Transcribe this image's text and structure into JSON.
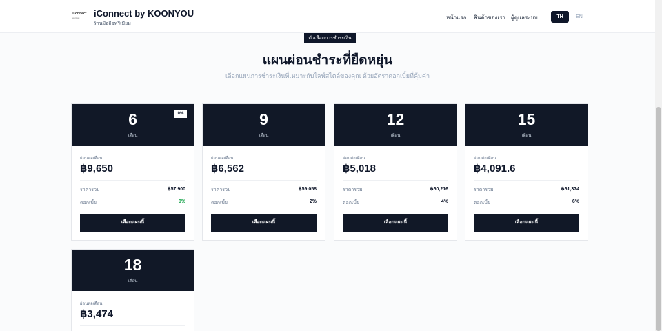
{
  "header": {
    "logo_text": "iConnect",
    "logo_sub": "koonyou",
    "brand_title": "iConnect by KOONYOU",
    "brand_subtitle": "ร้านมือถือพรีเมียม",
    "nav": [
      "หน้าแรก",
      "สินค้าของเรา",
      "ผู้ดูแลระบบ"
    ],
    "lang_active": "TH",
    "lang_other": "EN"
  },
  "section": {
    "badge": "ตัวเลือกการชำระเงิน",
    "title": "แผนผ่อนชำระที่ยืดหยุ่น",
    "description": "เลือกแผนการชำระเงินที่เหมาะกับไลฟ์สไตล์ของคุณ ด้วยอัตราดอกเบี้ยที่คุ้มค่า"
  },
  "labels": {
    "unit": "เดือน",
    "per_month": "ผ่อนต่อเดือน",
    "total": "ราคารวม",
    "interest": "ดอกเบี้ย",
    "select": "เลือกแผนนี้"
  },
  "plans": [
    {
      "months": "6",
      "tag": "0%",
      "per_month": "฿9,650",
      "total": "฿57,900",
      "interest": "0%"
    },
    {
      "months": "9",
      "per_month": "฿6,562",
      "total": "฿59,058",
      "interest": "2%"
    },
    {
      "months": "12",
      "per_month": "฿5,018",
      "total": "฿60,216",
      "interest": "4%"
    },
    {
      "months": "15",
      "per_month": "฿4,091.6",
      "total": "฿61,374",
      "interest": "6%"
    },
    {
      "months": "18",
      "per_month": "฿3,474"
    }
  ],
  "colors": {
    "dark": "#111827",
    "green": "#16a34a",
    "muted": "#94a3b8"
  }
}
